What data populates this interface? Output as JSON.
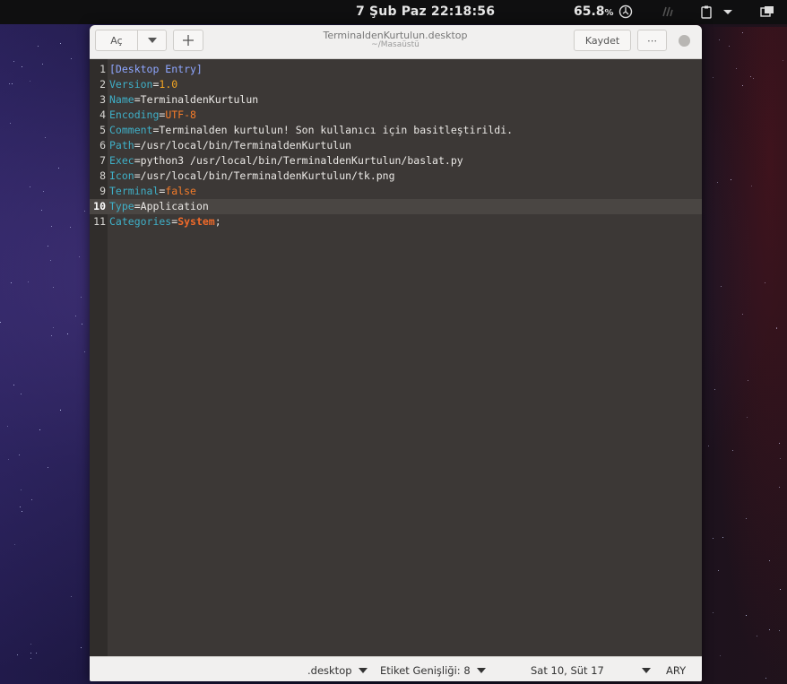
{
  "topbar": {
    "clock": "7 Şub Paz  22:18:56",
    "battery_value": "65.8",
    "battery_unit": "%",
    "icons": [
      "power-icon",
      "weather-icon",
      "clipboard-icon",
      "chevron-down-icon",
      "window-switcher-icon"
    ]
  },
  "header": {
    "open_label": "Aç",
    "save_label": "Kaydet",
    "menu_label": "⋯",
    "new_label": "+",
    "title": "TerminaldenKurtulun.desktop",
    "subtitle": "~/Masaüstü"
  },
  "editor": {
    "current_line": 10,
    "lines": [
      {
        "no": "1",
        "key": "",
        "sep": "",
        "value": "",
        "section": "[Desktop Entry]"
      },
      {
        "no": "2",
        "key": "Version",
        "sep": "=",
        "value": "1.0",
        "section": ""
      },
      {
        "no": "3",
        "key": "Name",
        "sep": "=",
        "value": "TerminaldenKurtulun",
        "section": ""
      },
      {
        "no": "4",
        "key": "Encoding",
        "sep": "=",
        "value": "UTF-8",
        "section": ""
      },
      {
        "no": "5",
        "key": "Comment",
        "sep": "=",
        "value": "Terminalden kurtulun! Son kullanıcı için basitleştirildi.",
        "section": ""
      },
      {
        "no": "6",
        "key": "Path",
        "sep": "=",
        "value": "/usr/local/bin/TerminaldenKurtulun",
        "section": ""
      },
      {
        "no": "7",
        "key": "Exec",
        "sep": "=",
        "value": "python3 /usr/local/bin/TerminaldenKurtulun/baslat.py",
        "section": ""
      },
      {
        "no": "8",
        "key": "Icon",
        "sep": "=",
        "value": "/usr/local/bin/TerminaldenKurtulun/tk.png",
        "section": ""
      },
      {
        "no": "9",
        "key": "Terminal",
        "sep": "=",
        "value": "false",
        "section": ""
      },
      {
        "no": "10",
        "key": "Type",
        "sep": "=",
        "value": "Application",
        "section": ""
      },
      {
        "no": "11",
        "key": "Categories",
        "sep": "=",
        "value": "System",
        "tail": ";",
        "section": ""
      }
    ]
  },
  "status": {
    "language": ".desktop",
    "tab_width": "Etiket Genişliği: 8",
    "position": "Sat 10, Süt 17",
    "mode": "ARY"
  },
  "colors": {
    "editor_bg": "#3c3836",
    "key": "#3fb0c8",
    "section": "#8ea6ff",
    "number": "#f5a623",
    "keyword": "#f57c2a"
  }
}
